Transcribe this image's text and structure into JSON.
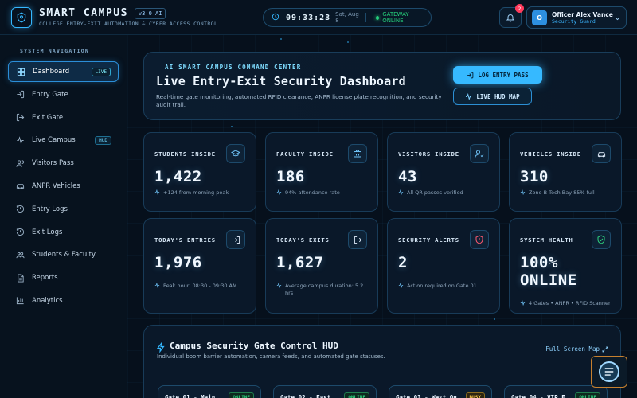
{
  "brand": {
    "title": "SMART CAMPUS",
    "version": "v3.0 AI",
    "subtitle": "College Entry-Exit Automation & Cyber Access Control",
    "logo_icon": "shield-icon",
    "accent_color": "#35b8ff"
  },
  "header": {
    "clock_time": "09:33:23",
    "clock_date": "Sat, Aug 8",
    "gateway_status": "GATEWAY ONLINE",
    "notification_count": "2",
    "user": {
      "initial": "O",
      "name": "Officer Alex Vance",
      "role": "Security Guard"
    }
  },
  "sidebar": {
    "heading": "SYSTEM NAVIGATION",
    "items": [
      {
        "label": "Dashboard",
        "icon": "dashboard-grid-icon",
        "tag": "LIVE",
        "active": true
      },
      {
        "label": "Entry Gate",
        "icon": "login-arrow-icon",
        "tag": ""
      },
      {
        "label": "Exit Gate",
        "icon": "logout-arrow-icon",
        "tag": ""
      },
      {
        "label": "Live Campus",
        "icon": "pulse-icon",
        "tag": "HUD"
      },
      {
        "label": "Visitors Pass",
        "icon": "users-icon",
        "tag": ""
      },
      {
        "label": "ANPR Vehicles",
        "icon": "car-icon",
        "tag": ""
      },
      {
        "label": "Entry Logs",
        "icon": "history-icon",
        "tag": ""
      },
      {
        "label": "Exit Logs",
        "icon": "history-icon",
        "tag": ""
      },
      {
        "label": "Students & Faculty",
        "icon": "group-icon",
        "tag": ""
      },
      {
        "label": "Reports",
        "icon": "document-icon",
        "tag": ""
      },
      {
        "label": "Analytics",
        "icon": "bar-chart-icon",
        "tag": ""
      }
    ]
  },
  "hero": {
    "eyebrow": "AI SMART CAMPUS COMMAND CENTER",
    "title": "Live Entry-Exit Security Dashboard",
    "description": "Real-time gate monitoring, automated RFID clearance, ANPR license plate recognition, and security audit trail.",
    "primary_button": "LOG ENTRY PASS",
    "secondary_button": "LIVE HUD MAP"
  },
  "stats": [
    {
      "label": "STUDENTS INSIDE",
      "value": "1,422",
      "note": "+124 from morning peak",
      "icon": "graduation-cap-icon"
    },
    {
      "label": "FACULTY INSIDE",
      "value": "186",
      "note": "94% attendance rate",
      "icon": "briefcase-icon"
    },
    {
      "label": "VISITORS INSIDE",
      "value": "43",
      "note": "All QR passes verified",
      "icon": "user-check-icon"
    },
    {
      "label": "VEHICLES INSIDE",
      "value": "310",
      "note": "Zone B Tech Bay 85% full",
      "icon": "car-icon"
    },
    {
      "label": "TODAY'S ENTRIES",
      "value": "1,976",
      "note": "Peak hour: 08:30 - 09:30 AM",
      "icon": "login-arrow-icon"
    },
    {
      "label": "TODAY'S EXITS",
      "value": "1,627",
      "note": "Average campus duration: 5.2 hrs",
      "icon": "logout-arrow-icon"
    },
    {
      "label": "SECURITY ALERTS",
      "value": "2",
      "note": "Action required on Gate 01",
      "icon": "shield-alert-icon"
    },
    {
      "label": "SYSTEM HEALTH",
      "value": "100% ONLINE",
      "note": "4 Gates • ANPR • RFID Scanner",
      "icon": "shield-check-icon"
    }
  ],
  "hud": {
    "title": "Campus Security Gate Control HUD",
    "subtitle": "Individual boom barrier automation, camera feeds, and automated gate statuses.",
    "fullscreen_label": "Full Screen Map",
    "gates": [
      {
        "name": "Gate 01 - Main Cy...",
        "status": "ONLINE"
      },
      {
        "name": "Gate 02 - East Te...",
        "status": "ONLINE"
      },
      {
        "name": "Gate 03 - West Qu...",
        "status": "BUSY"
      },
      {
        "name": "Gate 04 - VIP Ex...",
        "status": "ONLINE"
      }
    ]
  },
  "colors": {
    "online": "#2fd17e",
    "busy": "#ffc94a",
    "alert": "#ff3b5c"
  }
}
